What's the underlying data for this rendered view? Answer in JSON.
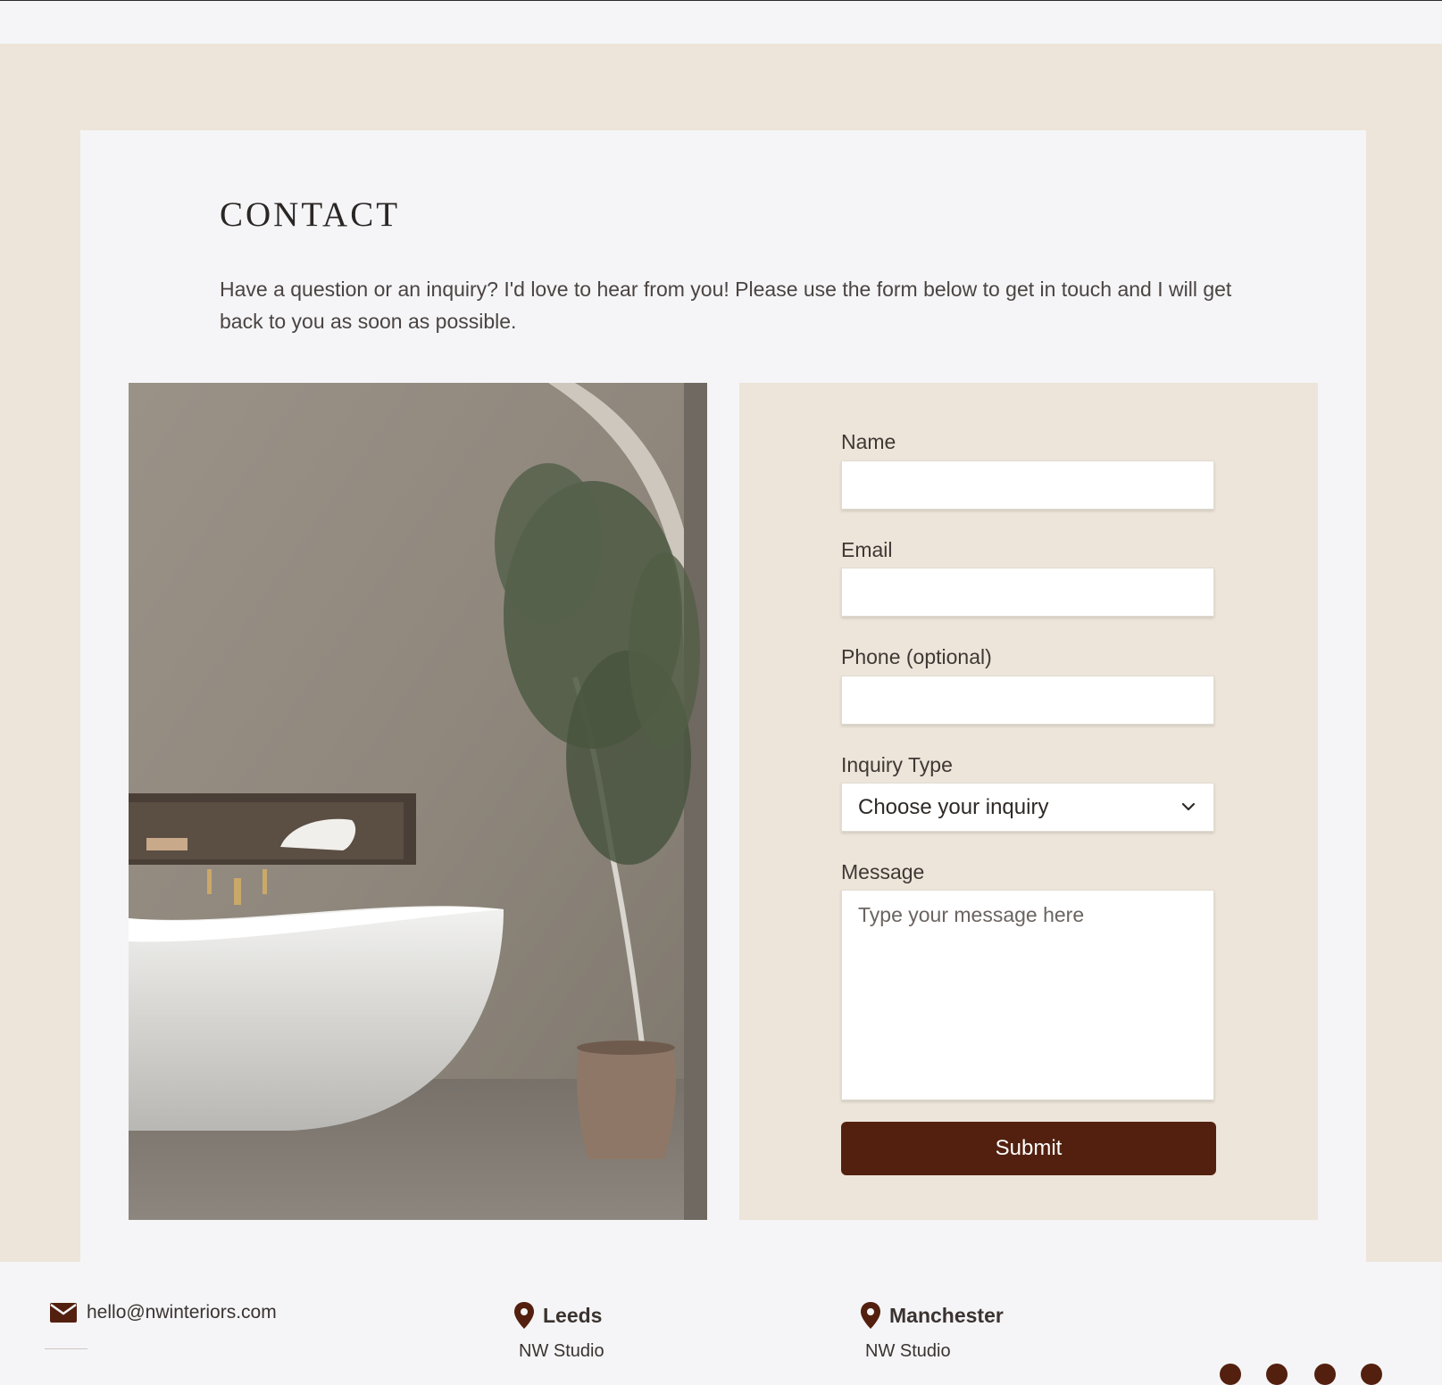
{
  "contact": {
    "title": "CONTACT",
    "intro": "Have a question or an inquiry? I'd love to hear from you! Please use the form below to get in touch and I will get back to you as soon as possible."
  },
  "form": {
    "name_label": "Name",
    "email_label": "Email",
    "phone_label": "Phone (optional)",
    "inquiry_label": "Inquiry Type",
    "inquiry_selected": "Choose your inquiry",
    "message_label": "Message",
    "message_placeholder": "Type your message here",
    "submit_label": "Submit"
  },
  "footer": {
    "email": "hello@nwinteriors.com",
    "locations": [
      {
        "city": "Leeds",
        "studio": "NW Studio"
      },
      {
        "city": "Manchester",
        "studio": "NW Studio"
      }
    ]
  },
  "colors": {
    "accent": "#53200f",
    "band": "#ede5d9",
    "card": "#f5f5f7"
  },
  "icons": [
    "envelope-icon",
    "map-pin-icon",
    "chevron-down-icon",
    "social-icon"
  ]
}
